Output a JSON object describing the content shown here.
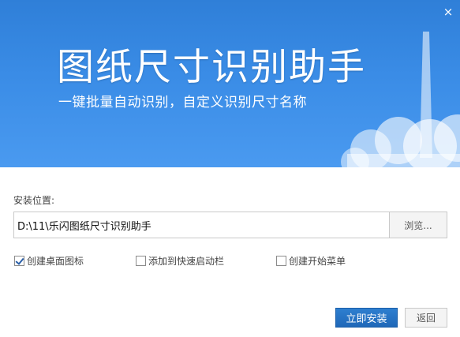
{
  "banner": {
    "title": "图纸尺寸识别助手",
    "subtitle": "一键批量自动识别，自定义识别尺寸名称",
    "close_glyph": "×"
  },
  "install": {
    "label": "安装位置:",
    "path_value": "D:\\11\\乐闪图纸尺寸识别助手",
    "browse_label": "浏览..."
  },
  "options": [
    {
      "label": "创建桌面图标",
      "checked": true
    },
    {
      "label": "添加到快速启动栏",
      "checked": false
    },
    {
      "label": "创建开始菜单",
      "checked": false
    }
  ],
  "buttons": {
    "install_label": "立即安装",
    "back_label": "返回"
  },
  "colors": {
    "banner_blue": "#3a8ce6",
    "primary_button": "#1f68b8"
  }
}
